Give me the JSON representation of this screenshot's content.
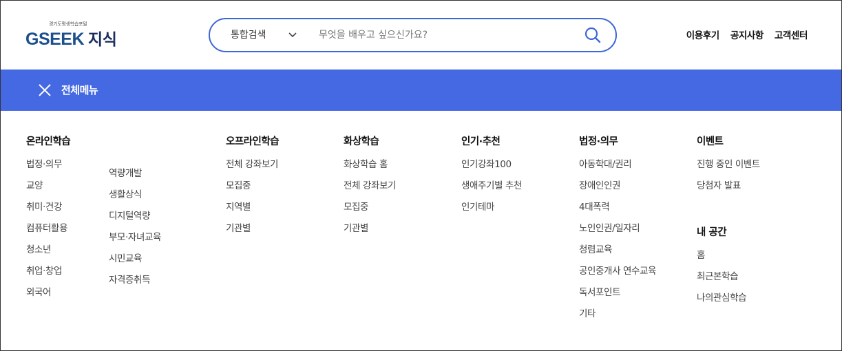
{
  "logo": {
    "subtitle": "경기도평생학습포털",
    "brand": "GSEEK",
    "brand_kr": "지식"
  },
  "search": {
    "category": "통합검색",
    "placeholder": "무엇을 배우고 싶으신가요?",
    "value": ""
  },
  "util_links": [
    "이용후기",
    "공지사항",
    "고객센터"
  ],
  "menubar": {
    "title": "전체메뉴"
  },
  "menu": {
    "online": {
      "title": "온라인학습",
      "col1": [
        "법정·의무",
        "교양",
        "취미·건강",
        "컴퓨터활용",
        "청소년",
        "취업·창업",
        "외국어"
      ],
      "col2": [
        "역량개발",
        "생활상식",
        "디지털역량",
        "부모·자녀교육",
        "시민교육",
        "자격증취득"
      ]
    },
    "offline": {
      "title": "오프라인학습",
      "items": [
        "전체 강좌보기",
        "모집중",
        "지역별",
        "기관별"
      ]
    },
    "video": {
      "title": "화상학습",
      "items": [
        "화상학습 홈",
        "전체 강좌보기",
        "모집중",
        "기관별"
      ]
    },
    "popular": {
      "title": "인기·추천",
      "items": [
        "인기강좌100",
        "생애주기별 추천",
        "인기테마"
      ]
    },
    "legal": {
      "title": "법정·의무",
      "items": [
        "아동학대/권리",
        "장애인인권",
        "4대폭력",
        "노인인권/일자리",
        "청렴교육",
        "공인중개사 연수교육",
        "독서포인트",
        "기타"
      ]
    },
    "event": {
      "title": "이벤트",
      "items": [
        "진행 중인 이벤트",
        "당첨자 발표"
      ]
    },
    "myspace": {
      "title": "내 공간",
      "items": [
        "홈",
        "최근본학습",
        "나의관심학습"
      ]
    }
  }
}
